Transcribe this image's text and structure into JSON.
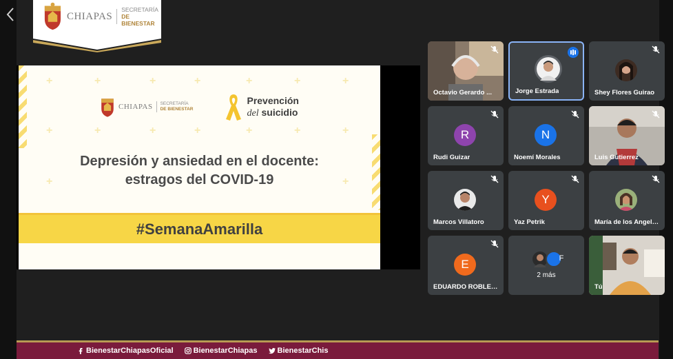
{
  "banner": {
    "brand_name": "CHIAPAS",
    "secretaria": "SECRETARÍA",
    "bienestar": "DE BIENESTAR"
  },
  "slide": {
    "brand_name": "CHIAPAS",
    "secretaria": "SECRETARÍA",
    "bienestar": "DE BIENESTAR",
    "prevencion": "Prevención",
    "del": "del",
    "suicidio": "suicidio",
    "title_line1": "Depresión y ansiedad en el docente:",
    "title_line2": "estragos del COVID-19",
    "hashtag": "#SemanaAmarilla"
  },
  "participants": [
    {
      "name": "Octavio Gerardo ...",
      "type": "video",
      "muted": true
    },
    {
      "name": "Jorge Estrada",
      "type": "photo",
      "speaking": true
    },
    {
      "name": "Shey Flores Guirao",
      "type": "photo",
      "muted": true
    },
    {
      "name": "Rudi Guizar",
      "initial": "R",
      "color": "#8e44ad",
      "muted": true
    },
    {
      "name": "Noemí Morales",
      "initial": "N",
      "color": "#1a73e8",
      "muted": true
    },
    {
      "name": "Luis Gutierrez",
      "type": "video",
      "muted": true
    },
    {
      "name": "Marcos Villatoro",
      "type": "photo",
      "muted": true
    },
    {
      "name": "Yaz Petrik",
      "initial": "Y",
      "color": "#e8501e",
      "muted": true
    },
    {
      "name": "María de los Angele...",
      "type": "photo",
      "muted": true
    },
    {
      "name": "EDUARDO ROBLER...",
      "initial": "E",
      "color": "#f06a1d",
      "muted": true
    },
    {
      "name": "2 más",
      "type": "more",
      "extra_initial": "F"
    },
    {
      "name": "Tú",
      "type": "video"
    }
  ],
  "footer": {
    "facebook": "BienestarChiapasOficial",
    "instagram": "BienestarChiapas",
    "twitter": "BienestarChis"
  }
}
